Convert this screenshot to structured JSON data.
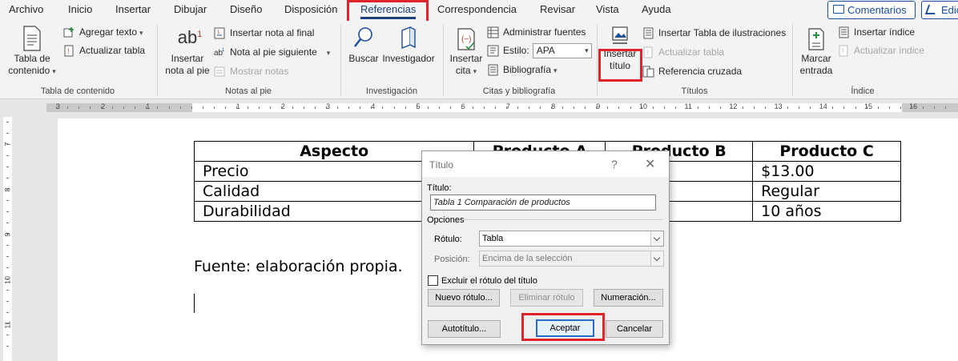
{
  "tabs": [
    "Archivo",
    "Inicio",
    "Insertar",
    "Dibujar",
    "Diseño",
    "Disposición",
    "Referencias",
    "Correspondencia",
    "Revisar",
    "Vista",
    "Ayuda"
  ],
  "active_tab": "Referencias",
  "header_buttons": {
    "comments": "Comentarios",
    "edit": "Edic"
  },
  "ribbon": {
    "tabla_contenido": {
      "big_line1": "Tabla de",
      "big_line2": "contenido",
      "agregar_texto": "Agregar texto",
      "actualizar_tabla": "Actualizar tabla",
      "group_label": "Tabla de contenido"
    },
    "notas": {
      "big_icon_text": "ab",
      "big_icon_sup": "1",
      "big_line1": "Insertar",
      "big_line2": "nota al pie",
      "insertar_nota_final": "Insertar nota al final",
      "nota_siguiente": "Nota al pie siguiente",
      "mostrar_notas": "Mostrar notas",
      "group_label": "Notas al pie"
    },
    "investigacion": {
      "buscar": "Buscar",
      "investigador": "Investigador",
      "group_label": "Investigación"
    },
    "citas": {
      "big_line1": "Insertar",
      "big_line2": "cita",
      "administrar_fuentes": "Administrar fuentes",
      "estilo_label": "Estilo:",
      "estilo_value": "APA",
      "bibliografia": "Bibliografía",
      "group_label": "Citas y bibliografía"
    },
    "titulos": {
      "big_line1": "Insertar",
      "big_line2": "título",
      "insertar_tabla_ilustraciones": "Insertar Tabla de ilustraciones",
      "actualizar_tabla": "Actualizar tabla",
      "referencia_cruzada": "Referencia cruzada",
      "group_label": "Títulos"
    },
    "indice": {
      "big_line1": "Marcar",
      "big_line2": "entrada",
      "insertar_indice": "Insertar índice",
      "actualizar_indice": "Actualizar índice",
      "group_label": "Índice"
    }
  },
  "ruler": {
    "h_left": [
      "3",
      "2",
      "1"
    ],
    "h_right": [
      "1",
      "2",
      "3",
      "4",
      "5",
      "6",
      "7",
      "8",
      "9",
      "10",
      "11",
      "12",
      "13",
      "14",
      "15",
      "16"
    ],
    "v": [
      "7",
      "8",
      "9",
      "10",
      "11"
    ]
  },
  "document": {
    "table": {
      "headers": [
        "Aspecto",
        "Producto A",
        "Producto B",
        "Producto C"
      ],
      "rows": [
        [
          "Precio",
          "",
          "",
          "$13.00"
        ],
        [
          "Calidad",
          "",
          "nte",
          "Regular"
        ],
        [
          "Durabilidad",
          "",
          "",
          "10 años"
        ]
      ]
    },
    "source_text": "Fuente: elaboración propia."
  },
  "dialog": {
    "title": "Título",
    "help": "?",
    "close": "✕",
    "titulo_label": "Título:",
    "titulo_value": "Tabla 1 Comparación de productos",
    "opciones_label": "Opciones",
    "rotulo_label": "Rótulo:",
    "rotulo_value": "Tabla",
    "posicion_label": "Posición:",
    "posicion_value": "Encima de la selección",
    "excluir_label": "Excluir el rótulo del título",
    "nuevo_rotulo": "Nuevo rótulo...",
    "eliminar_rotulo": "Eliminar rótulo",
    "numeracion": "Numeración...",
    "autotitulo": "Autotítulo...",
    "aceptar": "Aceptar",
    "cancelar": "Cancelar"
  },
  "colors": {
    "accent": "#1b3f7a",
    "highlight_box": "#e0242b",
    "link_blue": "#1b4e9b"
  },
  "icons": [
    "comment-icon",
    "edit-icon",
    "toc-icon",
    "add-text-icon",
    "refresh-icon",
    "footnote-icon",
    "endnote-icon",
    "next-footnote-icon",
    "show-notes-icon",
    "search-icon",
    "researcher-icon",
    "citation-icon",
    "manage-sources-icon",
    "bibliography-icon",
    "insert-caption-icon",
    "table-of-figures-icon",
    "cross-reference-icon",
    "mark-entry-icon",
    "index-icon"
  ]
}
